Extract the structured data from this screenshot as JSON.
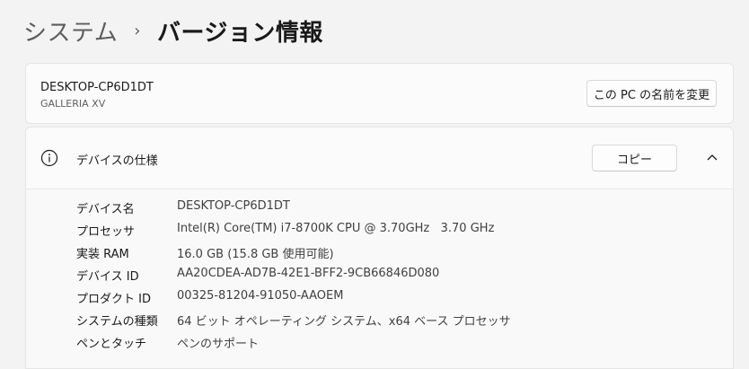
{
  "breadcrumb": {
    "parent": "システム",
    "separator": "›",
    "current": "バージョン情報"
  },
  "device": {
    "name": "DESKTOP-CP6D1DT",
    "model": "GALLERIA XV",
    "rename_label": "この PC の名前を変更"
  },
  "spec": {
    "title": "デバイスの仕様",
    "copy_label": "コピー",
    "icons": {
      "info": "info-icon",
      "collapse": "chevron-up-icon"
    },
    "rows": [
      {
        "label": "デバイス名",
        "value": "DESKTOP-CP6D1DT"
      },
      {
        "label": "プロセッサ",
        "value": "Intel(R) Core(TM) i7-8700K CPU @ 3.70GHz   3.70 GHz"
      },
      {
        "label": "実装 RAM",
        "value": "16.0 GB (15.8 GB 使用可能)"
      },
      {
        "label": "デバイス ID",
        "value": "AA20CDEA-AD7B-42E1-BFF2-9CB66846D080"
      },
      {
        "label": "プロダクト ID",
        "value": "00325-81204-91050-AAOEM"
      },
      {
        "label": "システムの種類",
        "value": "64 ビット オペレーティング システム、x64 ベース プロセッサ"
      },
      {
        "label": "ペンとタッチ",
        "value": "ペンのサポート"
      }
    ]
  }
}
